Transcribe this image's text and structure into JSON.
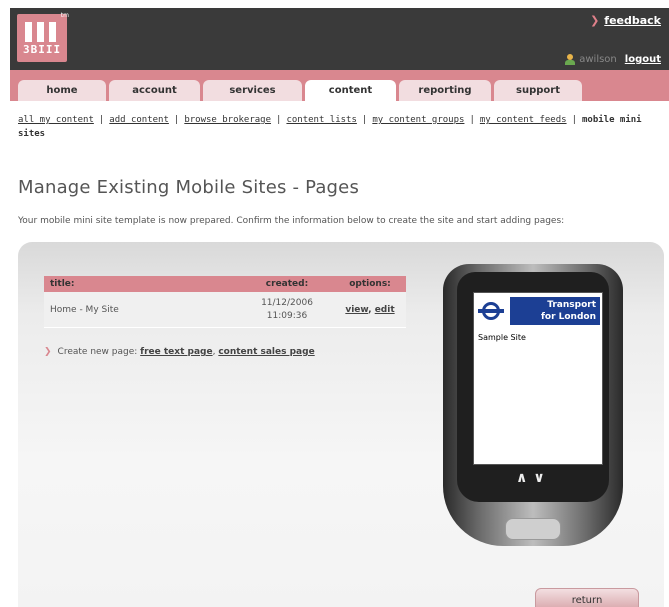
{
  "brand": {
    "logo_text": "3BIII",
    "tm": "tm",
    "accent": "#d9878f"
  },
  "header": {
    "feedback_label": "feedback",
    "username": "awilson",
    "logout_label": "logout"
  },
  "tabs": [
    {
      "label": "home",
      "active": false
    },
    {
      "label": "account",
      "active": false
    },
    {
      "label": "services",
      "active": false
    },
    {
      "label": "content",
      "active": true
    },
    {
      "label": "reporting",
      "active": false
    },
    {
      "label": "support",
      "active": false
    }
  ],
  "subnav": {
    "items": [
      "all my content",
      "add content",
      "browse brokerage",
      "content lists",
      "my content groups",
      "my content feeds"
    ],
    "current": "mobile mini sites"
  },
  "page": {
    "title": "Manage Existing Mobile Sites - Pages",
    "intro": "Your mobile mini site template is now prepared. Confirm the information below to create the site and start adding pages:"
  },
  "table": {
    "headers": {
      "title": "title:",
      "created": "created:",
      "options": "options:"
    },
    "rows": [
      {
        "title": "Home - My Site",
        "created_date": "11/12/2006",
        "created_time": "11:09:36",
        "view": "view",
        "sep": ",",
        "edit": "edit"
      }
    ]
  },
  "create": {
    "prefix": "Create new page:",
    "free_text": "free text page",
    "sep": ",",
    "content_sales": "content sales page"
  },
  "phone": {
    "tfl_line1": "Transport",
    "tfl_line2": "for London",
    "site_name": "Sample Site",
    "chevrons": "^v"
  },
  "return_label": "return"
}
